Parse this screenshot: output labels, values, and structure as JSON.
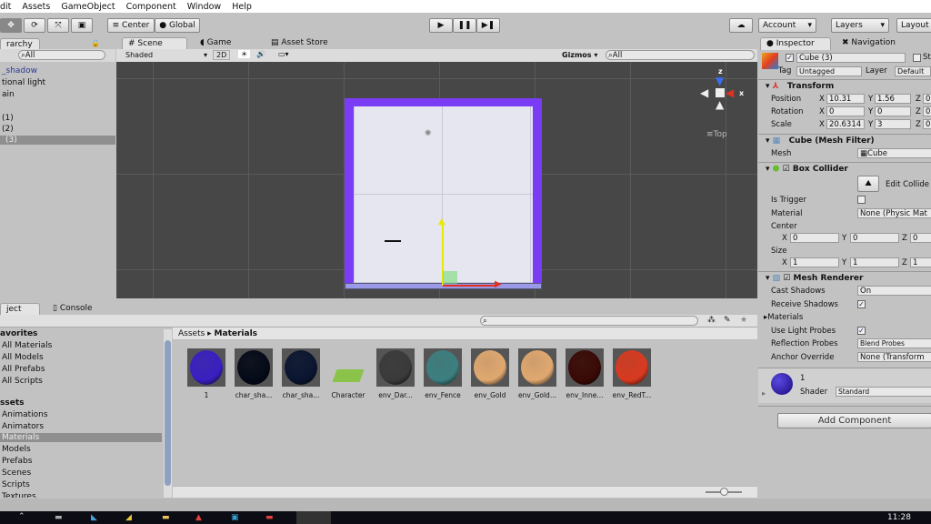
{
  "menu": [
    "dit",
    "Assets",
    "GameObject",
    "Component",
    "Window",
    "Help"
  ],
  "toolbar": {
    "pivot": "Center",
    "space": "Global",
    "account": "Account",
    "layers": "Layers",
    "layout": "Layout"
  },
  "hierarchy": {
    "tab": "rarchy",
    "search": "All",
    "items": [
      "_shadow",
      "tional light",
      "ain",
      "",
      "(1)",
      "(2)",
      "(3)"
    ],
    "selected_index": 6
  },
  "scene": {
    "tabs": [
      "Scene",
      "Game",
      "Asset Store"
    ],
    "shading": "Shaded",
    "mode2d": "2D",
    "gizmos": "Gizmos",
    "search": "All",
    "view_label": "Top",
    "axis_z": "z",
    "axis_x": "x",
    "colors": {
      "cube_border": "#7b3cf5",
      "cube_face": "#e6e6f0",
      "background": "#474747"
    }
  },
  "inspector": {
    "tabs": [
      "Inspector",
      "Navigation"
    ],
    "object_name": "Cube (3)",
    "static": "St",
    "tag_label": "Tag",
    "tag": "Untagged",
    "layer_label": "Layer",
    "layer": "Default",
    "transform": {
      "title": "Transform",
      "position_label": "Position",
      "rotation_label": "Rotation",
      "scale_label": "Scale",
      "position": [
        "10.31",
        "1.56",
        "0"
      ],
      "rotation": [
        "0",
        "0",
        "0"
      ],
      "scale": [
        "20.6314",
        "3",
        "0"
      ]
    },
    "mesh_filter": {
      "title": "Cube (Mesh Filter)",
      "mesh_label": "Mesh",
      "mesh": "Cube"
    },
    "box_collider": {
      "title": "Box Collider",
      "edit": "Edit Collide",
      "is_trigger": "Is Trigger",
      "material_label": "Material",
      "material": "None (Physic Mat",
      "center_label": "Center",
      "center": [
        "0",
        "0",
        "0"
      ],
      "size_label": "Size",
      "size": [
        "1",
        "1",
        "1"
      ]
    },
    "mesh_renderer": {
      "title": "Mesh Renderer",
      "cast_shadows": "Cast Shadows",
      "cast_value": "On",
      "receive_shadows": "Receive Shadows",
      "materials": "Materials",
      "light_probes": "Use Light Probes",
      "reflection_probes": "Reflection Probes",
      "reflection_value": "Blend Probes",
      "anchor_override": "Anchor Override",
      "anchor_value": "None (Transform"
    },
    "material": {
      "name": "1",
      "shader_label": "Shader",
      "shader": "Standard"
    },
    "add_component": "Add Component"
  },
  "project": {
    "tabs": [
      "ject",
      "Console"
    ],
    "favorites": "avorites",
    "fav_items": [
      "All Materials",
      "All Models",
      "All Prefabs",
      "All Scripts"
    ],
    "assets": "ssets",
    "asset_items": [
      "Animations",
      "Animators",
      "Materials",
      "Models",
      "Prefabs",
      "Scenes",
      "Scripts",
      "Textures"
    ],
    "selected": "Materials",
    "breadcrumb": [
      "Assets",
      "Materials"
    ],
    "items": [
      {
        "name": "1",
        "color": "#3a1fc0"
      },
      {
        "name": "char_sha...",
        "color": "#050a18"
      },
      {
        "name": "char_sha...",
        "color": "#0a1530"
      },
      {
        "name": "Character",
        "color": "#8bc34a"
      },
      {
        "name": "env_Dar...",
        "color": "#3a3a3a"
      },
      {
        "name": "env_Fence",
        "color": "#3d7f80"
      },
      {
        "name": "env_Gold",
        "color": "#e0a870"
      },
      {
        "name": "env_Gold...",
        "color": "#e0a870"
      },
      {
        "name": "env_Inne...",
        "color": "#3a0a05"
      },
      {
        "name": "env_RedT...",
        "color": "#d83a20"
      }
    ]
  },
  "taskbar": {
    "time": "11:28"
  }
}
